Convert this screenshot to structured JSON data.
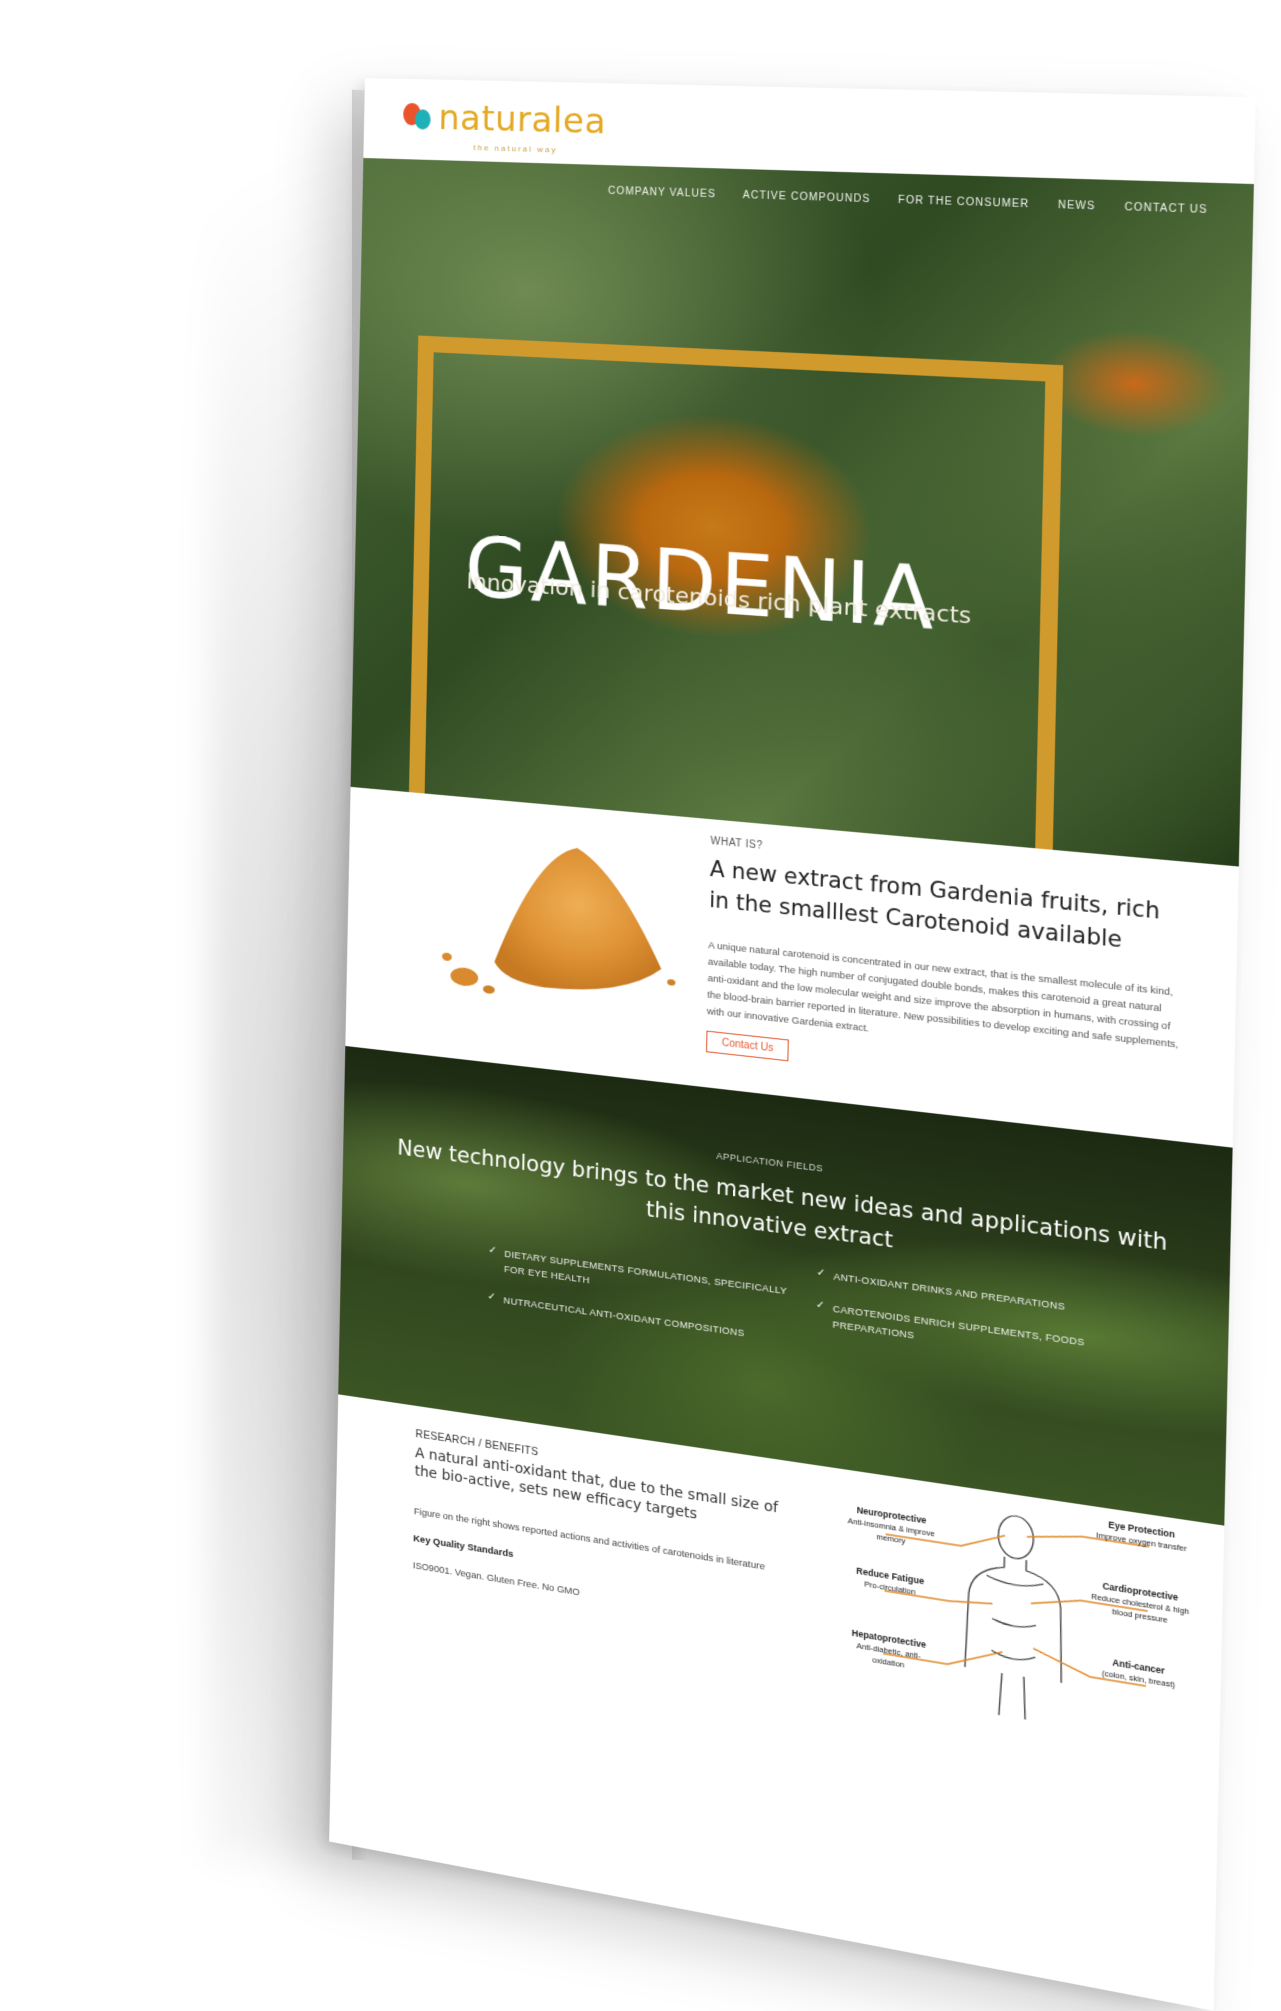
{
  "brand": {
    "logo_text": "naturalea",
    "tagline": "the natural way"
  },
  "nav": {
    "items": [
      "COMPANY VALUES",
      "ACTIVE COMPOUNDS",
      "FOR THE CONSUMER",
      "NEWS",
      "CONTACT US"
    ]
  },
  "hero": {
    "title": "GARDENIA",
    "subtitle": "Innovation in carotenoids rich plant extracts",
    "accent_color": "#d19a2d"
  },
  "whatis": {
    "kicker": "WHAT IS?",
    "title": "A new extract from Gardenia fruits, rich in the smalllest Carotenoid available",
    "body": "A unique natural carotenoid is concentrated in our new extract, that is the smallest molecule of its kind, available today. The high number of conjugated double bonds, makes this carotenoid a great natural anti-oxidant and the low molecular weight and size improve the absorption in humans, with crossing of the blood-brain barrier reported in literature. New possibilities to develop exciting and safe supplements, with our innovative Gardenia extract.",
    "button_label": "Contact Us",
    "button_color": "#e55a2e"
  },
  "applications": {
    "kicker": "APPLICATION FIELDS",
    "title": "New technology brings to the market new ideas and applications with this innovative extract",
    "left_items": [
      "DIETARY SUPPLEMENTS FORMULATIONS, SPECIFICALLY FOR EYE HEALTH",
      "NUTRACEUTICAL ANTI-OXIDANT COMPOSITIONS"
    ],
    "right_items": [
      "ANTI-OXIDANT DRINKS AND PREPARATIONS",
      "CAROTENOIDS ENRICH SUPPLEMENTS, FOODS PREPARATIONS"
    ]
  },
  "research": {
    "kicker": "RESEARCH / BENEFITS",
    "title": "A natural anti-oxidant that, due to the small size of the bio-active, sets new efficacy targets",
    "note": "Figure on the right shows reported actions and activities of carotenoids in literature",
    "standards_title": "Key Quality Standards",
    "standards": "ISO9001. Vegan. Gluten Free. No GMO",
    "figure": {
      "neuro_title": "Neuroprotective",
      "neuro_sub": "Anti-insomnia & improve memory",
      "fatigue_title": "Reduce Fatigue",
      "fatigue_sub": "Pro-circulation",
      "hepato_title": "Hepatoprotective",
      "hepato_sub": "Anti-diabetic, anti-oxidation",
      "eye_title": "Eye Protection",
      "eye_sub": "Improve oxygen transfer",
      "cardio_title": "Cardioprotective",
      "cardio_sub": "Reduce cholesterol & high blood pressure",
      "cancer_title": "Anti-cancer",
      "cancer_sub": "(colon, skin, breast)",
      "line_color": "#e08a2a"
    }
  }
}
